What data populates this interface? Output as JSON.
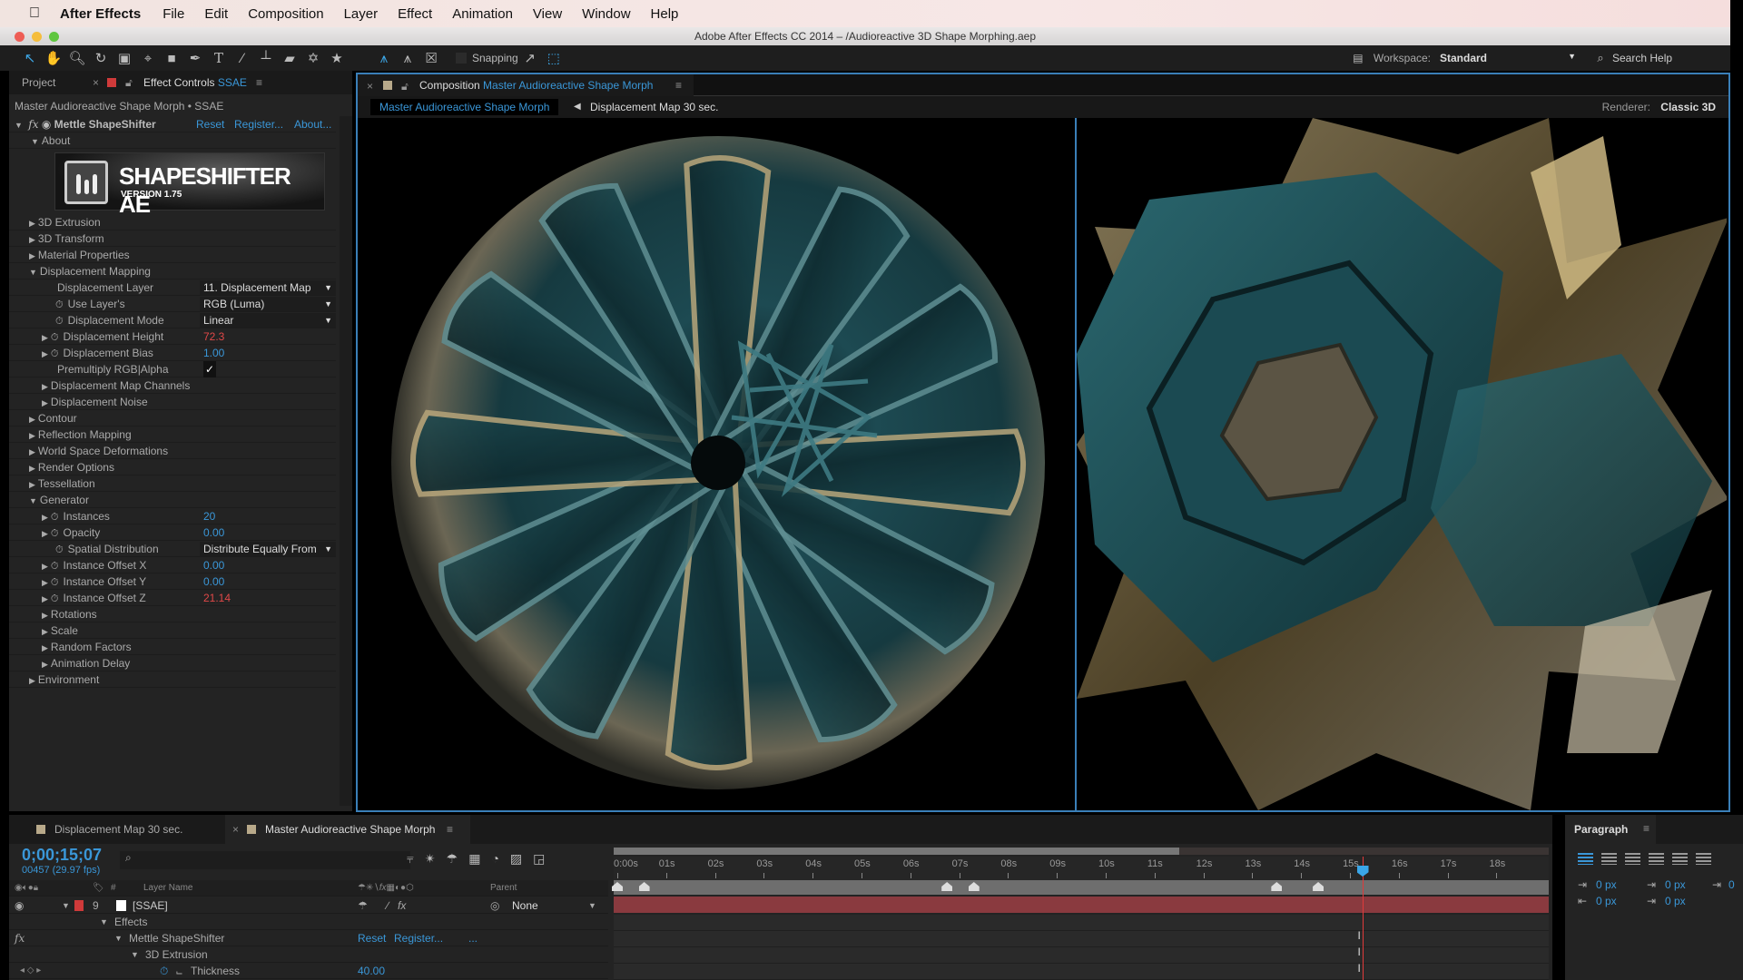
{
  "menubar": {
    "app_name": "After Effects",
    "items": [
      "File",
      "Edit",
      "Composition",
      "Layer",
      "Effect",
      "Animation",
      "View",
      "Window",
      "Help"
    ]
  },
  "window": {
    "title": "Adobe After Effects CC 2014 – /Audioreactive 3D Shape Morphing.aep"
  },
  "toolbar": {
    "tools": [
      "selection-tool",
      "hand-tool",
      "zoom-tool",
      "rotation-tool",
      "camera-tool",
      "pan-behind-tool",
      "rectangle-tool",
      "pen-tool",
      "type-tool",
      "brush-tool",
      "clone-stamp-tool",
      "eraser-tool",
      "roto-brush-tool",
      "puppet-pin-tool"
    ],
    "axis_tools": [
      "local-axis",
      "world-axis",
      "view-axis"
    ],
    "snapping_label": "Snapping",
    "workspace_label": "Workspace:",
    "workspace_value": "Standard",
    "search_help": "Search Help"
  },
  "left_panel": {
    "tab_project": "Project",
    "tab_effect_controls": "Effect Controls",
    "tab_effect_controls_layer": "SSAE",
    "breadcrumb": "Master Audioreactive Shape Morph • SSAE",
    "effect_name": "Mettle ShapeShifter",
    "reset": "Reset",
    "register": "Register...",
    "about": "About...",
    "about_group": "About",
    "logo_title": "SHAPESHIFTER AE",
    "logo_version": "VERSION 1.75",
    "rows": [
      {
        "label": "3D Extrusion",
        "indent": 1,
        "tri": "closed"
      },
      {
        "label": "3D Transform",
        "indent": 1,
        "tri": "closed"
      },
      {
        "label": "Material Properties",
        "indent": 1,
        "tri": "closed"
      },
      {
        "label": "Displacement Mapping",
        "indent": 1,
        "tri": "open"
      },
      {
        "label": "Displacement Layer",
        "indent": 2,
        "dropdown": "11. Displacement Map"
      },
      {
        "label": "Use Layer's",
        "indent": 2,
        "stopwatch": true,
        "dropdown": "RGB (Luma)"
      },
      {
        "label": "Displacement Mode",
        "indent": 2,
        "stopwatch": true,
        "dropdown": "Linear"
      },
      {
        "label": "Displacement Height",
        "indent": 2,
        "tri": "closed",
        "stopwatch": true,
        "value": "72.3",
        "color": "red"
      },
      {
        "label": "Displacement Bias",
        "indent": 2,
        "tri": "closed",
        "stopwatch": true,
        "value": "1.00",
        "color": "blue"
      },
      {
        "label": "Premultiply RGB|Alpha",
        "indent": 2,
        "checkbox": true
      },
      {
        "label": "Displacement Map Channels",
        "indent": 2,
        "tri": "closed"
      },
      {
        "label": "Displacement Noise",
        "indent": 2,
        "tri": "closed"
      },
      {
        "label": "Contour",
        "indent": 1,
        "tri": "closed"
      },
      {
        "label": "Reflection Mapping",
        "indent": 1,
        "tri": "closed"
      },
      {
        "label": "World Space Deformations",
        "indent": 1,
        "tri": "closed"
      },
      {
        "label": "Render Options",
        "indent": 1,
        "tri": "closed"
      },
      {
        "label": "Tessellation",
        "indent": 1,
        "tri": "closed"
      },
      {
        "label": "Generator",
        "indent": 1,
        "tri": "open"
      },
      {
        "label": "Instances",
        "indent": 2,
        "tri": "closed",
        "stopwatch": true,
        "value": "20",
        "color": "blue"
      },
      {
        "label": "Opacity",
        "indent": 2,
        "tri": "closed",
        "stopwatch": true,
        "value": "0.00",
        "color": "blue"
      },
      {
        "label": "Spatial Distribution",
        "indent": 2,
        "stopwatch": true,
        "dropdown": "Distribute Equally From"
      },
      {
        "label": "Instance Offset X",
        "indent": 2,
        "tri": "closed",
        "stopwatch": true,
        "value": "0.00",
        "color": "blue"
      },
      {
        "label": "Instance Offset Y",
        "indent": 2,
        "tri": "closed",
        "stopwatch": true,
        "value": "0.00",
        "color": "blue"
      },
      {
        "label": "Instance Offset Z",
        "indent": 2,
        "tri": "closed",
        "stopwatch": true,
        "value": "21.14",
        "color": "red"
      },
      {
        "label": "Rotations",
        "indent": 2,
        "tri": "closed"
      },
      {
        "label": "Scale",
        "indent": 2,
        "tri": "closed"
      },
      {
        "label": "Random Factors",
        "indent": 2,
        "tri": "closed"
      },
      {
        "label": "Animation Delay",
        "indent": 2,
        "tri": "closed"
      },
      {
        "label": "Environment",
        "indent": 1,
        "tri": "closed"
      }
    ]
  },
  "viewer": {
    "tab_prefix": "Composition",
    "tab_comp_name": "Master Audioreactive Shape Morph",
    "crumb_active": "Master Audioreactive Shape Morph",
    "crumb_next": "Displacement Map 30 sec.",
    "renderer_label": "Renderer:",
    "renderer_value": "Classic 3D"
  },
  "timeline": {
    "tab_inactive": "Displacement Map 30 sec.",
    "tab_active": "Master Audioreactive Shape Morph",
    "timecode": "0;00;15;07",
    "frame_info": "00457 (29.97 fps)",
    "columns": {
      "num": "#",
      "layer_name": "Layer Name",
      "parent": "Parent"
    },
    "layer": {
      "number": "9",
      "name": "[SSAE]",
      "parent": "None"
    },
    "effects_label": "Effects",
    "effect_name": "Mettle ShapeShifter",
    "reset": "Reset",
    "register": "Register...",
    "more": "...",
    "group": "3D Extrusion",
    "property": "Thickness",
    "property_value": "40.00",
    "ruler_ticks": [
      "0:00s",
      "01s",
      "02s",
      "03s",
      "04s",
      "05s",
      "06s",
      "07s",
      "08s",
      "09s",
      "10s",
      "11s",
      "12s",
      "13s",
      "14s",
      "15s",
      "16s",
      "17s",
      "18s"
    ],
    "playhead_seconds": 15.25,
    "work_area_end_seconds": 11.5,
    "markers_seconds": [
      0.0,
      0.55,
      6.75,
      7.3,
      13.5,
      14.35
    ]
  },
  "paragraph": {
    "title": "Paragraph",
    "indent_left": "0 px",
    "indent_right": "0 px",
    "indent_first": "0",
    "space_before": "0 px",
    "space_after": "0 px"
  }
}
